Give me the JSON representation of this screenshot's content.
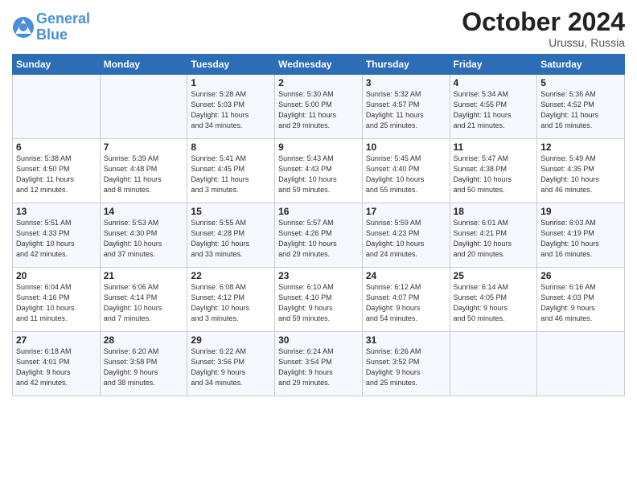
{
  "header": {
    "logo_line1": "General",
    "logo_line2": "Blue",
    "month": "October 2024",
    "location": "Urussu, Russia"
  },
  "weekdays": [
    "Sunday",
    "Monday",
    "Tuesday",
    "Wednesday",
    "Thursday",
    "Friday",
    "Saturday"
  ],
  "weeks": [
    [
      {
        "day": "",
        "info": ""
      },
      {
        "day": "",
        "info": ""
      },
      {
        "day": "1",
        "info": "Sunrise: 5:28 AM\nSunset: 5:03 PM\nDaylight: 11 hours\nand 34 minutes."
      },
      {
        "day": "2",
        "info": "Sunrise: 5:30 AM\nSunset: 5:00 PM\nDaylight: 11 hours\nand 29 minutes."
      },
      {
        "day": "3",
        "info": "Sunrise: 5:32 AM\nSunset: 4:57 PM\nDaylight: 11 hours\nand 25 minutes."
      },
      {
        "day": "4",
        "info": "Sunrise: 5:34 AM\nSunset: 4:55 PM\nDaylight: 11 hours\nand 21 minutes."
      },
      {
        "day": "5",
        "info": "Sunrise: 5:36 AM\nSunset: 4:52 PM\nDaylight: 11 hours\nand 16 minutes."
      }
    ],
    [
      {
        "day": "6",
        "info": "Sunrise: 5:38 AM\nSunset: 4:50 PM\nDaylight: 11 hours\nand 12 minutes."
      },
      {
        "day": "7",
        "info": "Sunrise: 5:39 AM\nSunset: 4:48 PM\nDaylight: 11 hours\nand 8 minutes."
      },
      {
        "day": "8",
        "info": "Sunrise: 5:41 AM\nSunset: 4:45 PM\nDaylight: 11 hours\nand 3 minutes."
      },
      {
        "day": "9",
        "info": "Sunrise: 5:43 AM\nSunset: 4:43 PM\nDaylight: 10 hours\nand 59 minutes."
      },
      {
        "day": "10",
        "info": "Sunrise: 5:45 AM\nSunset: 4:40 PM\nDaylight: 10 hours\nand 55 minutes."
      },
      {
        "day": "11",
        "info": "Sunrise: 5:47 AM\nSunset: 4:38 PM\nDaylight: 10 hours\nand 50 minutes."
      },
      {
        "day": "12",
        "info": "Sunrise: 5:49 AM\nSunset: 4:35 PM\nDaylight: 10 hours\nand 46 minutes."
      }
    ],
    [
      {
        "day": "13",
        "info": "Sunrise: 5:51 AM\nSunset: 4:33 PM\nDaylight: 10 hours\nand 42 minutes."
      },
      {
        "day": "14",
        "info": "Sunrise: 5:53 AM\nSunset: 4:30 PM\nDaylight: 10 hours\nand 37 minutes."
      },
      {
        "day": "15",
        "info": "Sunrise: 5:55 AM\nSunset: 4:28 PM\nDaylight: 10 hours\nand 33 minutes."
      },
      {
        "day": "16",
        "info": "Sunrise: 5:57 AM\nSunset: 4:26 PM\nDaylight: 10 hours\nand 29 minutes."
      },
      {
        "day": "17",
        "info": "Sunrise: 5:59 AM\nSunset: 4:23 PM\nDaylight: 10 hours\nand 24 minutes."
      },
      {
        "day": "18",
        "info": "Sunrise: 6:01 AM\nSunset: 4:21 PM\nDaylight: 10 hours\nand 20 minutes."
      },
      {
        "day": "19",
        "info": "Sunrise: 6:03 AM\nSunset: 4:19 PM\nDaylight: 10 hours\nand 16 minutes."
      }
    ],
    [
      {
        "day": "20",
        "info": "Sunrise: 6:04 AM\nSunset: 4:16 PM\nDaylight: 10 hours\nand 11 minutes."
      },
      {
        "day": "21",
        "info": "Sunrise: 6:06 AM\nSunset: 4:14 PM\nDaylight: 10 hours\nand 7 minutes."
      },
      {
        "day": "22",
        "info": "Sunrise: 6:08 AM\nSunset: 4:12 PM\nDaylight: 10 hours\nand 3 minutes."
      },
      {
        "day": "23",
        "info": "Sunrise: 6:10 AM\nSunset: 4:10 PM\nDaylight: 9 hours\nand 59 minutes."
      },
      {
        "day": "24",
        "info": "Sunrise: 6:12 AM\nSunset: 4:07 PM\nDaylight: 9 hours\nand 54 minutes."
      },
      {
        "day": "25",
        "info": "Sunrise: 6:14 AM\nSunset: 4:05 PM\nDaylight: 9 hours\nand 50 minutes."
      },
      {
        "day": "26",
        "info": "Sunrise: 6:16 AM\nSunset: 4:03 PM\nDaylight: 9 hours\nand 46 minutes."
      }
    ],
    [
      {
        "day": "27",
        "info": "Sunrise: 6:18 AM\nSunset: 4:01 PM\nDaylight: 9 hours\nand 42 minutes."
      },
      {
        "day": "28",
        "info": "Sunrise: 6:20 AM\nSunset: 3:58 PM\nDaylight: 9 hours\nand 38 minutes."
      },
      {
        "day": "29",
        "info": "Sunrise: 6:22 AM\nSunset: 3:56 PM\nDaylight: 9 hours\nand 34 minutes."
      },
      {
        "day": "30",
        "info": "Sunrise: 6:24 AM\nSunset: 3:54 PM\nDaylight: 9 hours\nand 29 minutes."
      },
      {
        "day": "31",
        "info": "Sunrise: 6:26 AM\nSunset: 3:52 PM\nDaylight: 9 hours\nand 25 minutes."
      },
      {
        "day": "",
        "info": ""
      },
      {
        "day": "",
        "info": ""
      }
    ]
  ]
}
